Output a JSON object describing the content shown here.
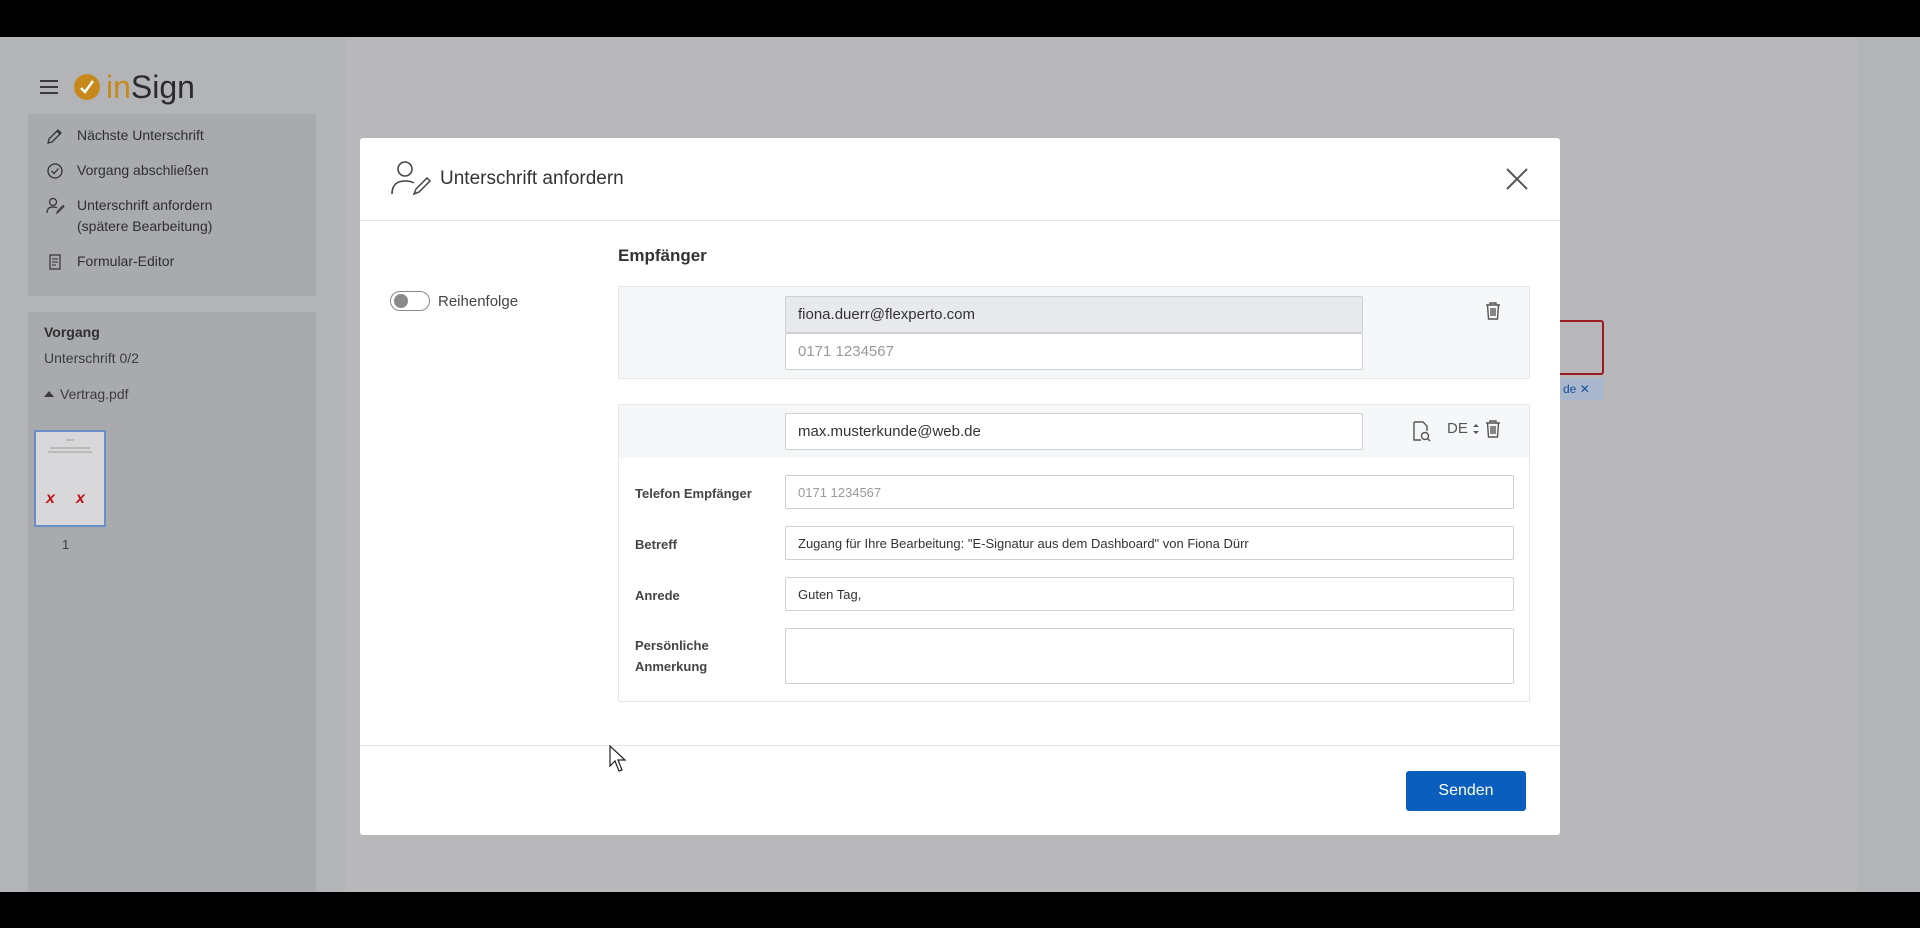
{
  "app": {
    "logo_prefix": "in",
    "logo_suffix": "Sign"
  },
  "menu": {
    "items": [
      {
        "label": "Nächste Unterschrift",
        "icon": "pen-icon"
      },
      {
        "label": "Vorgang abschließen",
        "icon": "check-circle-icon"
      },
      {
        "label": "Unterschrift anfordern",
        "label2": "(spätere Bearbeitung)",
        "icon": "user-sign-icon"
      },
      {
        "label": "Formular-Editor",
        "icon": "form-icon"
      }
    ]
  },
  "vorgang": {
    "title": "Vorgang",
    "status": "Unterschrift 0/2",
    "file": "Vertrag.pdf",
    "page_number": "1"
  },
  "document": {
    "tag_text": "de"
  },
  "modal": {
    "title": "Unterschrift anfordern",
    "order_label": "Reihenfolge",
    "recipients_title": "Empfänger",
    "recipient1": {
      "email": "fiona.duerr@flexperto.com",
      "phone_placeholder": "0171 1234567"
    },
    "recipient2": {
      "email": "max.musterkunde@web.de",
      "language": "DE",
      "phone_label": "Telefon Empfänger",
      "phone_placeholder": "0171 1234567",
      "subject_label": "Betreff",
      "subject_value": "Zugang für Ihre Bearbeitung: \"E-Signatur aus dem Dashboard\" von Fiona Dürr",
      "salutation_label": "Anrede",
      "salutation_value": "Guten Tag,",
      "note_label_1": "Persönliche",
      "note_label_2": "Anmerkung",
      "note_value": ""
    },
    "send_label": "Senden"
  },
  "colors": {
    "accent": "#0a5ebd",
    "logo": "#c8891c",
    "error": "#c0141a"
  }
}
